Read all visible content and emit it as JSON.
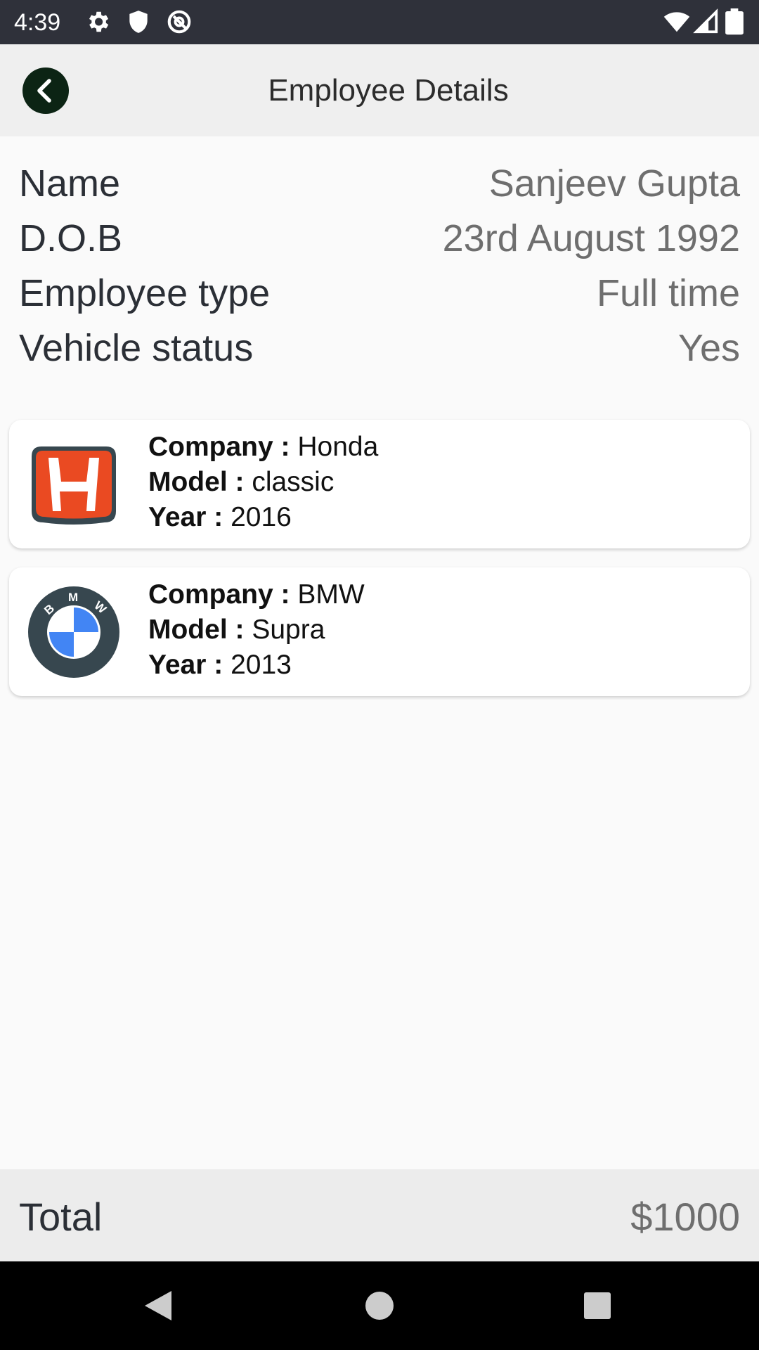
{
  "status_bar": {
    "time": "4:39",
    "icons_left": [
      "settings-gear-icon",
      "shield-icon",
      "vpn-circle-icon"
    ],
    "icons_right": [
      "wifi-icon",
      "cell-signal-icon",
      "battery-icon"
    ]
  },
  "app_bar": {
    "title": "Employee Details",
    "back_icon": "chevron-left-icon"
  },
  "details": [
    {
      "label": "Name",
      "value": "Sanjeev Gupta"
    },
    {
      "label": "D.O.B",
      "value": "23rd August 1992"
    },
    {
      "label": "Employee type",
      "value": "Full time"
    },
    {
      "label": "Vehicle status",
      "value": "Yes"
    }
  ],
  "vehicles": [
    {
      "logo": "honda-logo",
      "company_key": "Company :",
      "company": "Honda",
      "model_key": "Model :",
      "model": "classic",
      "year_key": "Year :",
      "year": "2016"
    },
    {
      "logo": "bmw-logo",
      "company_key": "Company :",
      "company": "BMW",
      "model_key": "Model :",
      "model": "Supra",
      "year_key": "Year :",
      "year": "2013"
    }
  ],
  "total": {
    "label": "Total",
    "value": "$1000"
  },
  "nav_bar": {
    "buttons": [
      "back-triangle-icon",
      "home-circle-icon",
      "recents-square-icon"
    ]
  },
  "colors": {
    "status_bar_bg": "#2f313a",
    "app_bar_bg": "#efefef",
    "back_button_bg": "#0c2414",
    "honda_red": "#ea4a22",
    "bmw_blue": "#4285f4",
    "logo_dark": "#37474f"
  }
}
